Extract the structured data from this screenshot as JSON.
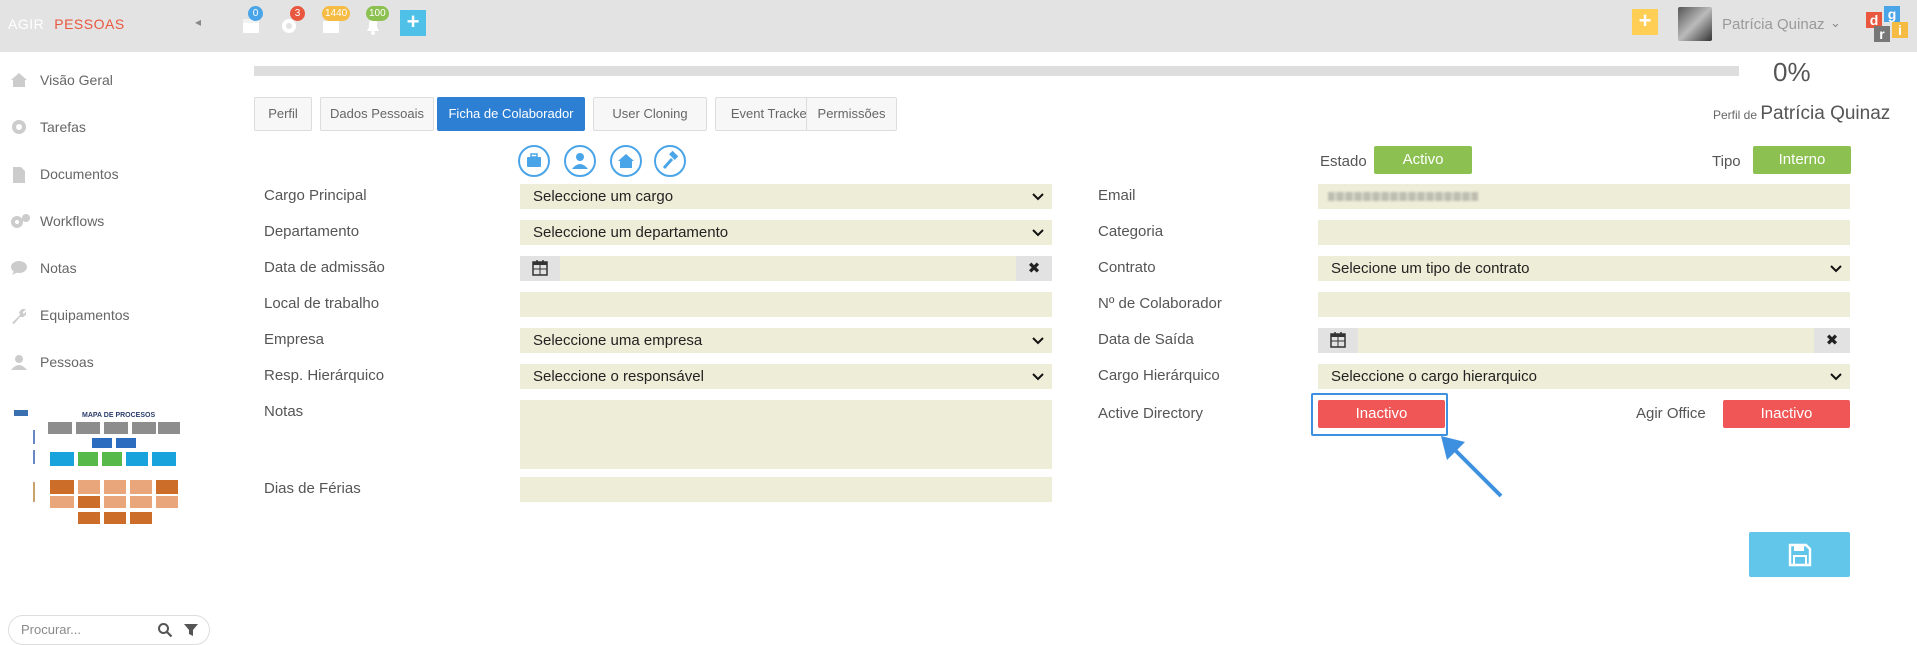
{
  "topbar": {
    "brand_part1": "AGIR",
    "brand_part2": "PESSOAS",
    "collapse_glyph": "◂",
    "badges": {
      "calendar": "0",
      "settings": "3",
      "inbox": "1440",
      "bell": "100"
    },
    "add_glyph": "+",
    "user_name": "Patrícia Quinaz",
    "user_chevron": "⌄",
    "logo_letters": [
      "d",
      "g",
      "r",
      "i"
    ],
    "colors": {
      "calendar_badge": "#4aa5e8",
      "settings_badge": "#e9573f",
      "inbox_badge": "#f6bb42",
      "bell_badge": "#8cc152",
      "add_blue": "#4fc1e9",
      "add_yellow": "#ffce54"
    }
  },
  "sidebar": {
    "items": [
      {
        "label": "Visão Geral",
        "icon": "home-icon"
      },
      {
        "label": "Tarefas",
        "icon": "gear-icon"
      },
      {
        "label": "Documentos",
        "icon": "document-icon"
      },
      {
        "label": "Workflows",
        "icon": "gears-icon"
      },
      {
        "label": "Notas",
        "icon": "comments-icon"
      },
      {
        "label": "Equipamentos",
        "icon": "wrench-icon"
      },
      {
        "label": "Pessoas",
        "icon": "user-icon"
      }
    ],
    "process_map_title": "MAPA DE PROCESOS",
    "search_placeholder": "Procurar..."
  },
  "main": {
    "progress_percent": 0,
    "progress_label": "0%",
    "profile_prefix": "Perfil de",
    "profile_name": "Patrícia Quinaz",
    "tabs": [
      {
        "label": "Perfil"
      },
      {
        "label": "Dados Pessoais"
      },
      {
        "label": "Ficha de Colaborador",
        "active": true
      },
      {
        "label": "User Cloning"
      },
      {
        "label": "Event Tracker"
      },
      {
        "label": "Permissões"
      }
    ],
    "section_icons": [
      "briefcase-icon",
      "user-tie-icon",
      "home-icon",
      "hammer-icon"
    ],
    "left": {
      "cargo_principal": {
        "label": "Cargo Principal",
        "value": "Seleccione um cargo"
      },
      "departamento": {
        "label": "Departamento",
        "value": "Seleccione um departamento"
      },
      "data_admissao": {
        "label": "Data de admissão",
        "value": ""
      },
      "local_trabalho": {
        "label": "Local de trabalho",
        "value": ""
      },
      "empresa": {
        "label": "Empresa",
        "value": "Seleccione uma empresa"
      },
      "resp_hierarquico": {
        "label": "Resp. Hierárquico",
        "value": "Seleccione o responsável"
      },
      "notas": {
        "label": "Notas",
        "value": ""
      },
      "dias_ferias": {
        "label": "Dias de Férias",
        "value": ""
      }
    },
    "right": {
      "estado": {
        "label": "Estado",
        "value": "Activo"
      },
      "tipo": {
        "label": "Tipo",
        "value": "Interno"
      },
      "email": {
        "label": "Email",
        "value": ""
      },
      "categoria": {
        "label": "Categoria",
        "value": ""
      },
      "contrato": {
        "label": "Contrato",
        "value": "Selecione um tipo de contrato"
      },
      "n_colaborador": {
        "label": "Nº de Colaborador",
        "value": ""
      },
      "data_saida": {
        "label": "Data de Saída",
        "value": ""
      },
      "cargo_hierarquico": {
        "label": "Cargo Hierárquico",
        "value": "Seleccione o cargo hierarquico"
      },
      "active_directory": {
        "label": "Active Directory",
        "value": "Inactivo"
      },
      "agir_office": {
        "label": "Agir Office",
        "value": "Inactivo"
      }
    },
    "clear_glyph": "✖",
    "select_caret": "⌄",
    "colors": {
      "active_tab": "#2d7fd4",
      "green": "#8cc152",
      "red": "#f05656",
      "field_bg": "#eeeed8",
      "save": "#62c6ea",
      "annotation_arrow": "#3d8fe0"
    }
  }
}
